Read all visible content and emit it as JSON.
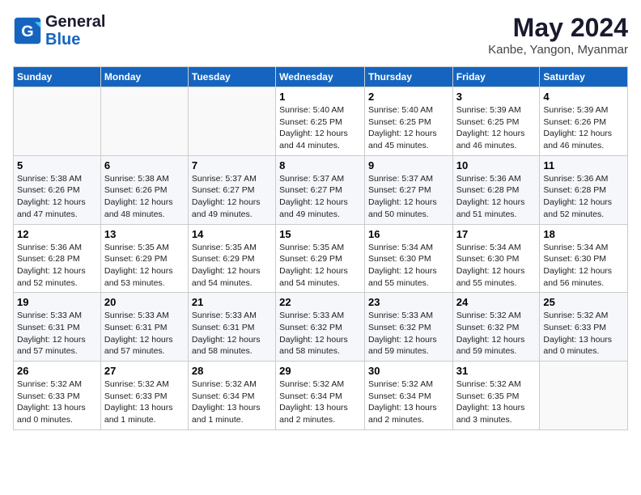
{
  "header": {
    "logo_line1": "General",
    "logo_line2": "Blue",
    "month_title": "May 2024",
    "location": "Kanbe, Yangon, Myanmar"
  },
  "days_of_week": [
    "Sunday",
    "Monday",
    "Tuesday",
    "Wednesday",
    "Thursday",
    "Friday",
    "Saturday"
  ],
  "weeks": [
    [
      {
        "day": "",
        "info": ""
      },
      {
        "day": "",
        "info": ""
      },
      {
        "day": "",
        "info": ""
      },
      {
        "day": "1",
        "info": "Sunrise: 5:40 AM\nSunset: 6:25 PM\nDaylight: 12 hours\nand 44 minutes."
      },
      {
        "day": "2",
        "info": "Sunrise: 5:40 AM\nSunset: 6:25 PM\nDaylight: 12 hours\nand 45 minutes."
      },
      {
        "day": "3",
        "info": "Sunrise: 5:39 AM\nSunset: 6:25 PM\nDaylight: 12 hours\nand 46 minutes."
      },
      {
        "day": "4",
        "info": "Sunrise: 5:39 AM\nSunset: 6:26 PM\nDaylight: 12 hours\nand 46 minutes."
      }
    ],
    [
      {
        "day": "5",
        "info": "Sunrise: 5:38 AM\nSunset: 6:26 PM\nDaylight: 12 hours\nand 47 minutes."
      },
      {
        "day": "6",
        "info": "Sunrise: 5:38 AM\nSunset: 6:26 PM\nDaylight: 12 hours\nand 48 minutes."
      },
      {
        "day": "7",
        "info": "Sunrise: 5:37 AM\nSunset: 6:27 PM\nDaylight: 12 hours\nand 49 minutes."
      },
      {
        "day": "8",
        "info": "Sunrise: 5:37 AM\nSunset: 6:27 PM\nDaylight: 12 hours\nand 49 minutes."
      },
      {
        "day": "9",
        "info": "Sunrise: 5:37 AM\nSunset: 6:27 PM\nDaylight: 12 hours\nand 50 minutes."
      },
      {
        "day": "10",
        "info": "Sunrise: 5:36 AM\nSunset: 6:28 PM\nDaylight: 12 hours\nand 51 minutes."
      },
      {
        "day": "11",
        "info": "Sunrise: 5:36 AM\nSunset: 6:28 PM\nDaylight: 12 hours\nand 52 minutes."
      }
    ],
    [
      {
        "day": "12",
        "info": "Sunrise: 5:36 AM\nSunset: 6:28 PM\nDaylight: 12 hours\nand 52 minutes."
      },
      {
        "day": "13",
        "info": "Sunrise: 5:35 AM\nSunset: 6:29 PM\nDaylight: 12 hours\nand 53 minutes."
      },
      {
        "day": "14",
        "info": "Sunrise: 5:35 AM\nSunset: 6:29 PM\nDaylight: 12 hours\nand 54 minutes."
      },
      {
        "day": "15",
        "info": "Sunrise: 5:35 AM\nSunset: 6:29 PM\nDaylight: 12 hours\nand 54 minutes."
      },
      {
        "day": "16",
        "info": "Sunrise: 5:34 AM\nSunset: 6:30 PM\nDaylight: 12 hours\nand 55 minutes."
      },
      {
        "day": "17",
        "info": "Sunrise: 5:34 AM\nSunset: 6:30 PM\nDaylight: 12 hours\nand 55 minutes."
      },
      {
        "day": "18",
        "info": "Sunrise: 5:34 AM\nSunset: 6:30 PM\nDaylight: 12 hours\nand 56 minutes."
      }
    ],
    [
      {
        "day": "19",
        "info": "Sunrise: 5:33 AM\nSunset: 6:31 PM\nDaylight: 12 hours\nand 57 minutes."
      },
      {
        "day": "20",
        "info": "Sunrise: 5:33 AM\nSunset: 6:31 PM\nDaylight: 12 hours\nand 57 minutes."
      },
      {
        "day": "21",
        "info": "Sunrise: 5:33 AM\nSunset: 6:31 PM\nDaylight: 12 hours\nand 58 minutes."
      },
      {
        "day": "22",
        "info": "Sunrise: 5:33 AM\nSunset: 6:32 PM\nDaylight: 12 hours\nand 58 minutes."
      },
      {
        "day": "23",
        "info": "Sunrise: 5:33 AM\nSunset: 6:32 PM\nDaylight: 12 hours\nand 59 minutes."
      },
      {
        "day": "24",
        "info": "Sunrise: 5:32 AM\nSunset: 6:32 PM\nDaylight: 12 hours\nand 59 minutes."
      },
      {
        "day": "25",
        "info": "Sunrise: 5:32 AM\nSunset: 6:33 PM\nDaylight: 13 hours\nand 0 minutes."
      }
    ],
    [
      {
        "day": "26",
        "info": "Sunrise: 5:32 AM\nSunset: 6:33 PM\nDaylight: 13 hours\nand 0 minutes."
      },
      {
        "day": "27",
        "info": "Sunrise: 5:32 AM\nSunset: 6:33 PM\nDaylight: 13 hours\nand 1 minute."
      },
      {
        "day": "28",
        "info": "Sunrise: 5:32 AM\nSunset: 6:34 PM\nDaylight: 13 hours\nand 1 minute."
      },
      {
        "day": "29",
        "info": "Sunrise: 5:32 AM\nSunset: 6:34 PM\nDaylight: 13 hours\nand 2 minutes."
      },
      {
        "day": "30",
        "info": "Sunrise: 5:32 AM\nSunset: 6:34 PM\nDaylight: 13 hours\nand 2 minutes."
      },
      {
        "day": "31",
        "info": "Sunrise: 5:32 AM\nSunset: 6:35 PM\nDaylight: 13 hours\nand 3 minutes."
      },
      {
        "day": "",
        "info": ""
      }
    ]
  ]
}
